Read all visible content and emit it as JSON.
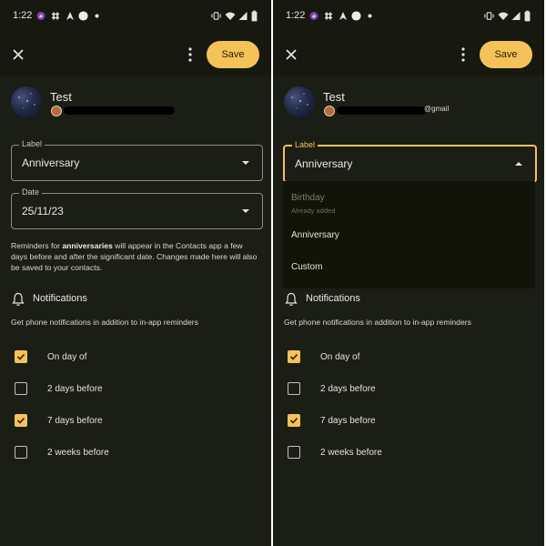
{
  "colors": {
    "accent": "#f5c25a",
    "background": "#1b1e15",
    "surface": "#171910",
    "dropdown": "#121409"
  },
  "screens": [
    {
      "status_time": "1:22",
      "toolbar": {
        "save_label": "Save"
      },
      "contact": {
        "name": "Test"
      },
      "label_field": {
        "legend": "Label",
        "value": "Anniversary"
      },
      "date_field": {
        "legend": "Date",
        "value": "25/11/23"
      },
      "info": {
        "part1": "Reminders for ",
        "bold": "anniversaries",
        "part2": " will appear in the Contacts app a few days before and after the significant date. Changes made here will also be saved to your contacts."
      },
      "notifications": {
        "title": "Notifications",
        "description": "Get phone notifications in addition to in-app reminders"
      },
      "reminders": [
        {
          "label": "On day of",
          "checked": true
        },
        {
          "label": "2 days before",
          "checked": false
        },
        {
          "label": "7 days before",
          "checked": true
        },
        {
          "label": "2 weeks before",
          "checked": false
        }
      ]
    },
    {
      "status_time": "1:22",
      "toolbar": {
        "save_label": "Save"
      },
      "contact": {
        "name": "Test",
        "email_fragment": "@gmail"
      },
      "label_field": {
        "legend": "Label",
        "value": "Anniversary"
      },
      "dropdown": {
        "options": [
          {
            "label": "Birthday",
            "subtext": "Already added",
            "disabled": true
          },
          {
            "label": "Anniversary",
            "subtext": "",
            "disabled": false
          },
          {
            "label": "Custom",
            "subtext": "",
            "disabled": false
          }
        ]
      },
      "notifications": {
        "title": "Notifications",
        "description": "Get phone notifications in addition to in-app reminders"
      },
      "reminders": [
        {
          "label": "On day of",
          "checked": true
        },
        {
          "label": "2 days before",
          "checked": false
        },
        {
          "label": "7 days before",
          "checked": true
        },
        {
          "label": "2 weeks before",
          "checked": false
        }
      ]
    }
  ]
}
